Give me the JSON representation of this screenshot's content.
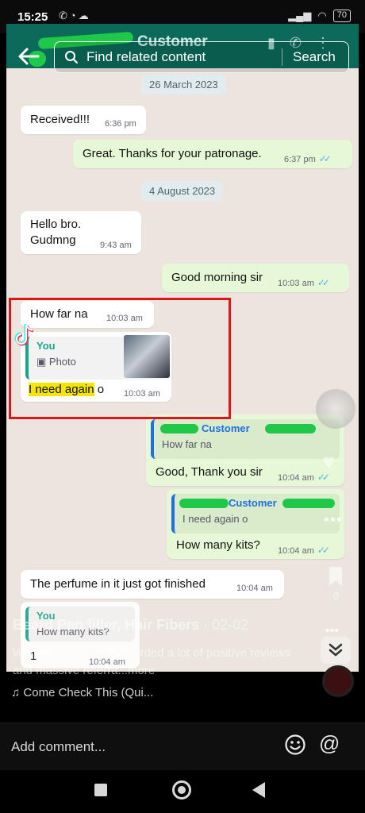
{
  "status_bar": {
    "time": "15:25",
    "battery": "70"
  },
  "chat": {
    "header_title": "Customer",
    "date_1": "26 March 2023",
    "date_2": "4 August 2023",
    "messages": [
      {
        "text": "Received!!!",
        "time": "6:36 pm"
      },
      {
        "text": "Great. Thanks for your patronage.",
        "time": "6:37 pm"
      },
      {
        "text_line1": "Hello bro.",
        "text_line2": "Gudmng",
        "time": "9:43 am"
      },
      {
        "text": "Good morning sir",
        "time": "10:03 am"
      },
      {
        "text": "How far na",
        "time": "10:03 am"
      },
      {
        "quote_name": "You",
        "quote_text": "Photo",
        "text_a": "I need ",
        "text_b": "again",
        "text_c": " o",
        "time": "10:03 am"
      },
      {
        "quote_name": "Customer",
        "quote_text": "How far na",
        "text": "Good, Thank you sir",
        "time": "10:04 am"
      },
      {
        "quote_name": "Customer",
        "quote_text": "I need again o",
        "text": "How many kits?",
        "time": "10:04 am"
      },
      {
        "text": "The perfume in it just got finished",
        "time": "10:04 am"
      },
      {
        "quote_name": "You",
        "quote_text": "How many kits?",
        "text": "1",
        "time": "10:04 am"
      }
    ]
  },
  "search": {
    "placeholder": "Find related content",
    "button": "Search"
  },
  "video_overlay": {
    "title": "Beard Pen filler, Hair Fibers",
    "date": " · 02-02",
    "description": "We would not have recorded a lot of positive reviews and massive referra...more"
  },
  "side_actions": {
    "comments_count": "0"
  },
  "music": {
    "label": "Come Check This (Qui..."
  },
  "comment_bar": {
    "placeholder": "Add comment..."
  },
  "colors": {
    "highlight": "#f5e600",
    "annotation_box": "#e0151a",
    "read_ticks": "#4fb6ec",
    "outgoing_bubble": "#e6f8d6",
    "quote_name": "#1aa58a"
  },
  "icons": [
    "back-arrow-icon",
    "search-icon",
    "emoji-icon",
    "at-mention-icon",
    "music-note-icon",
    "bookmark-icon",
    "more-dots-icon",
    "chevron-down-icon",
    "square-nav-icon",
    "circle-nav-icon",
    "triangle-back-nav-icon",
    "tiktok-logo"
  ]
}
